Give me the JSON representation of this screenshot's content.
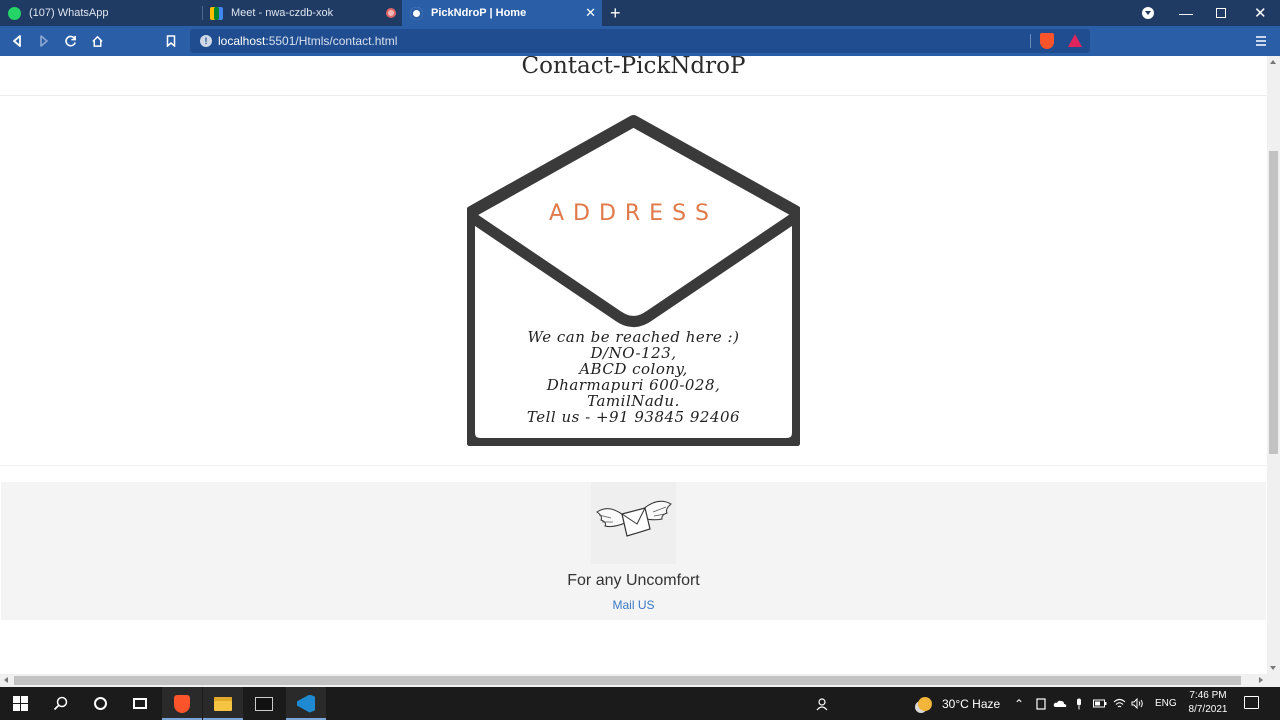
{
  "browser": {
    "tabs": [
      {
        "label": "(107) WhatsApp"
      },
      {
        "label": "Meet - nwa-czdb-xok"
      },
      {
        "label": "PickNdroP | Home"
      }
    ],
    "new_tab_glyph": "+",
    "close_glyph": "✕",
    "minimize_glyph": "—",
    "window_close_glyph": "✕",
    "address": {
      "host": "localhost",
      "path": ":5501/Htmls/contact.html"
    },
    "icons": [
      "back-icon",
      "forward-icon",
      "reload-icon",
      "home-icon",
      "bookmark-icon",
      "site-info-icon",
      "brave-shield-icon",
      "brave-rewards-icon",
      "menu-icon"
    ]
  },
  "page": {
    "title": "Contact-PickNdroP",
    "address_heading": "ADDRESS",
    "address_lines": [
      "We can be reached here :)",
      "D/NO-123,",
      "ABCD colony,",
      "Dharmapuri 600-028,",
      "TamilNadu.",
      "Tell us - +91 93845 92406"
    ],
    "footer": {
      "heading": "For any Uncomfort",
      "link": "Mail US"
    },
    "colors": {
      "accent": "#e07a4a",
      "link": "#3b78c4",
      "envelope": "#3a3a3a"
    }
  },
  "taskbar": {
    "weather": "30°C  Haze",
    "language": "ENG",
    "time": "7:46 PM",
    "date": "8/7/2021",
    "apps": [
      "windows-start-icon",
      "search-icon",
      "cortana-icon",
      "task-view-icon",
      "brave-icon",
      "file-explorer-icon",
      "terminal-icon",
      "vscode-icon"
    ]
  }
}
